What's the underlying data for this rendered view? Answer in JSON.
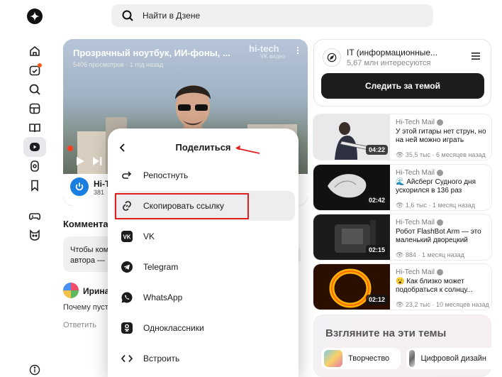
{
  "search": {
    "placeholder": "Найти в Дзене"
  },
  "sidebar": {
    "items": [
      {
        "name": "home-icon"
      },
      {
        "name": "subscriptions-icon"
      },
      {
        "name": "search-icon"
      },
      {
        "name": "articles-icon"
      },
      {
        "name": "reader-icon"
      },
      {
        "name": "video-icon"
      },
      {
        "name": "shorts-icon"
      },
      {
        "name": "bookmark-icon"
      },
      {
        "name": "games-icon"
      },
      {
        "name": "kids-icon"
      }
    ],
    "info_icon": "info-icon"
  },
  "video": {
    "title": "Прозрачный ноутбук, ИИ-фоны, ...",
    "views": "5406 просмотров · 1 год назад",
    "watermark": "hi-tech",
    "watermark_sub": "VK видео",
    "channel_name": "Hi-T",
    "channel_subs": "381"
  },
  "comments": {
    "title": "Коммента",
    "box_text_1": "Чтобы ком",
    "box_text_2": "автора —",
    "author": "Ирина",
    "text": "Почему пуст",
    "reply": "Ответить"
  },
  "share": {
    "title": "Поделиться",
    "items": [
      {
        "label": "Репостнуть",
        "icon": "repost-icon"
      },
      {
        "label": "Скопировать ссылку",
        "icon": "link-icon"
      },
      {
        "label": "VK",
        "icon": "vk-icon"
      },
      {
        "label": "Telegram",
        "icon": "telegram-icon"
      },
      {
        "label": "WhatsApp",
        "icon": "whatsapp-icon"
      },
      {
        "label": "Одноклассники",
        "icon": "ok-icon"
      },
      {
        "label": "Встроить",
        "icon": "embed-icon"
      }
    ]
  },
  "topic": {
    "name": "IT (информационные...",
    "interested": "5,67 млн интересуются",
    "follow_label": "Следить за темой"
  },
  "recommendations": [
    {
      "channel": "Hi-Tech Mail",
      "title": "У этой гитары нет струн, но на ней можно играть",
      "meta": "👁 35,5 тыс · 6 месяцев назад",
      "duration": "04:22"
    },
    {
      "channel": "Hi-Tech Mail",
      "title": "🌊 Айсберг Судного дня ускорился в 136 раз",
      "meta": "👁 1,6 тыс · 1 месяц назад",
      "duration": "02:42"
    },
    {
      "channel": "Hi-Tech Mail",
      "title": "Робот FlashBot Arm — это маленький дворецкий",
      "meta": "👁 884 · 1 месяц назад",
      "duration": "02:15"
    },
    {
      "channel": "Hi-Tech Mail",
      "title": "😮 Как близко может подобраться к солнцу...",
      "meta": "👁 23,2 тыс · 10 месяцев назад",
      "duration": "02:12"
    }
  ],
  "themes": {
    "title": "Взгляните на эти темы",
    "chips": [
      {
        "label": "Творчество"
      },
      {
        "label": "Цифровой дизайн"
      }
    ]
  },
  "colors": {
    "accent_red": "#e01f1f",
    "follow_button": "#1c1c1e",
    "progress": "#ff3b1f"
  }
}
